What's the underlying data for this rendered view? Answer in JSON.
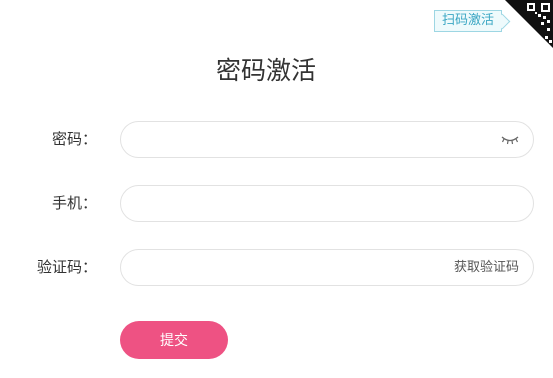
{
  "page": {
    "title": "密码激活"
  },
  "scan_tip": {
    "label": "扫码激活",
    "icon": "qr-code-icon"
  },
  "form": {
    "password": {
      "label": "密码：",
      "value": "",
      "icon": "eye-closed-icon"
    },
    "phone": {
      "label": "手机：",
      "value": ""
    },
    "verify_code": {
      "label": "验证码：",
      "value": "",
      "get_code_label": "获取验证码"
    },
    "submit_label": "提交"
  },
  "colors": {
    "primary": "#ee5283",
    "tip_text": "#3aa6c3",
    "tip_border": "#9dd6e3",
    "input_border": "#e2e2e2"
  }
}
